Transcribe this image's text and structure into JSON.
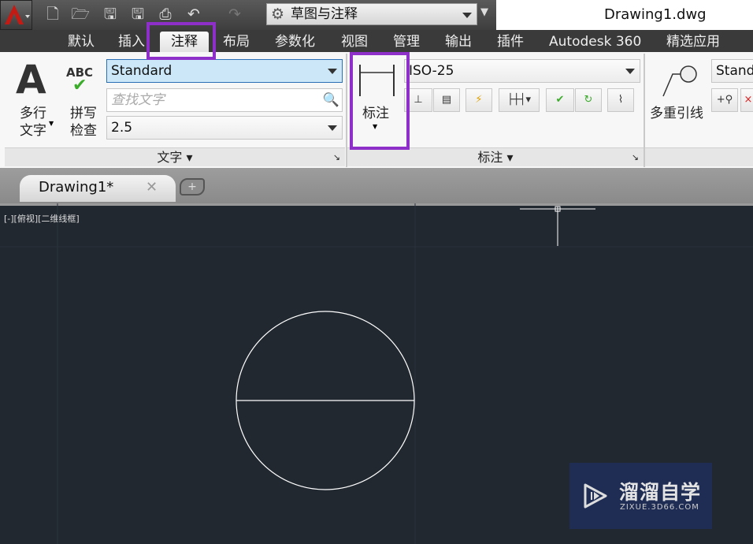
{
  "app": {
    "filename": "Drawing1.dwg",
    "workspace": "草图与注释",
    "logo": "autocad-a-logo"
  },
  "quick_access": [
    "new-icon",
    "open-icon",
    "save-icon",
    "save-as-icon",
    "print-icon",
    "undo-icon",
    "redo-icon"
  ],
  "ribbon_tabs": [
    {
      "label": "默认"
    },
    {
      "label": "插入"
    },
    {
      "label": "注释",
      "active": true
    },
    {
      "label": "布局"
    },
    {
      "label": "参数化"
    },
    {
      "label": "视图"
    },
    {
      "label": "管理"
    },
    {
      "label": "输出"
    },
    {
      "label": "插件"
    },
    {
      "label": "Autodesk 360"
    },
    {
      "label": "精选应用"
    }
  ],
  "text_panel": {
    "title": "文字",
    "mtext_line1": "多行",
    "mtext_line2": "文字",
    "spell_icon_text": "ABC",
    "spell_line1": "拼写",
    "spell_line2": "检查",
    "style": "Standard",
    "find_placeholder": "查找文字",
    "height": "2.5"
  },
  "dim_panel": {
    "title": "标注",
    "dim_button": "标注",
    "dim_style": "ISO-25"
  },
  "leader_panel": {
    "button": "多重引线",
    "style": "Standard"
  },
  "doc_tab": {
    "label": "Drawing1*"
  },
  "viewport": {
    "label": "[-][俯视][二维线框]"
  },
  "highlight_color": "#8e2fc9",
  "watermark": {
    "name": "溜溜自学",
    "url": "ZIXUE.3D66.COM"
  }
}
